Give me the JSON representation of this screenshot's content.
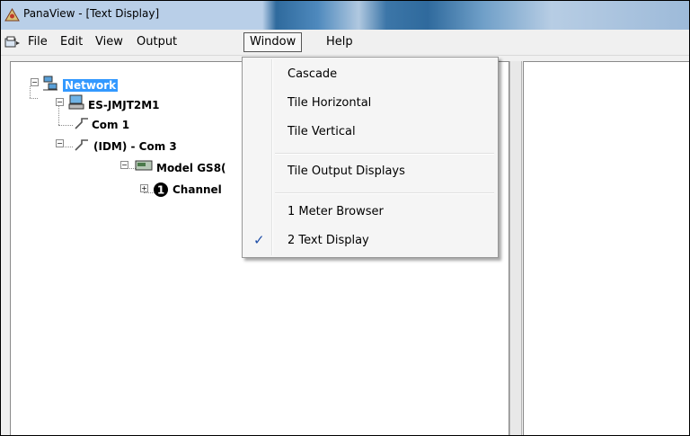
{
  "window": {
    "title": "PanaView - [Text Display]"
  },
  "menubar": {
    "items": [
      "File",
      "Edit",
      "View",
      "Output",
      "Window",
      "Help"
    ],
    "active": "Window"
  },
  "tree": {
    "root": "Network",
    "computer": "ES-JMJT2M1",
    "port1": "Com 1",
    "port2": "(IDM) - Com 3",
    "model": "Model GS8(",
    "channel": "Channel"
  },
  "window_menu": {
    "items": [
      "Cascade",
      "Tile Horizontal",
      "Tile Vertical",
      "Tile Output Displays",
      "1 Meter Browser",
      "2 Text Display"
    ],
    "checked_item": "2 Text Display"
  },
  "icons": {
    "app": "panaview-app-icon",
    "system_menu": "system-menu-icon",
    "network": "network-icon",
    "computer": "computer-icon",
    "port": "port-icon",
    "meter": "meter-icon",
    "channel": "channel-1-icon",
    "check": "check-icon"
  }
}
